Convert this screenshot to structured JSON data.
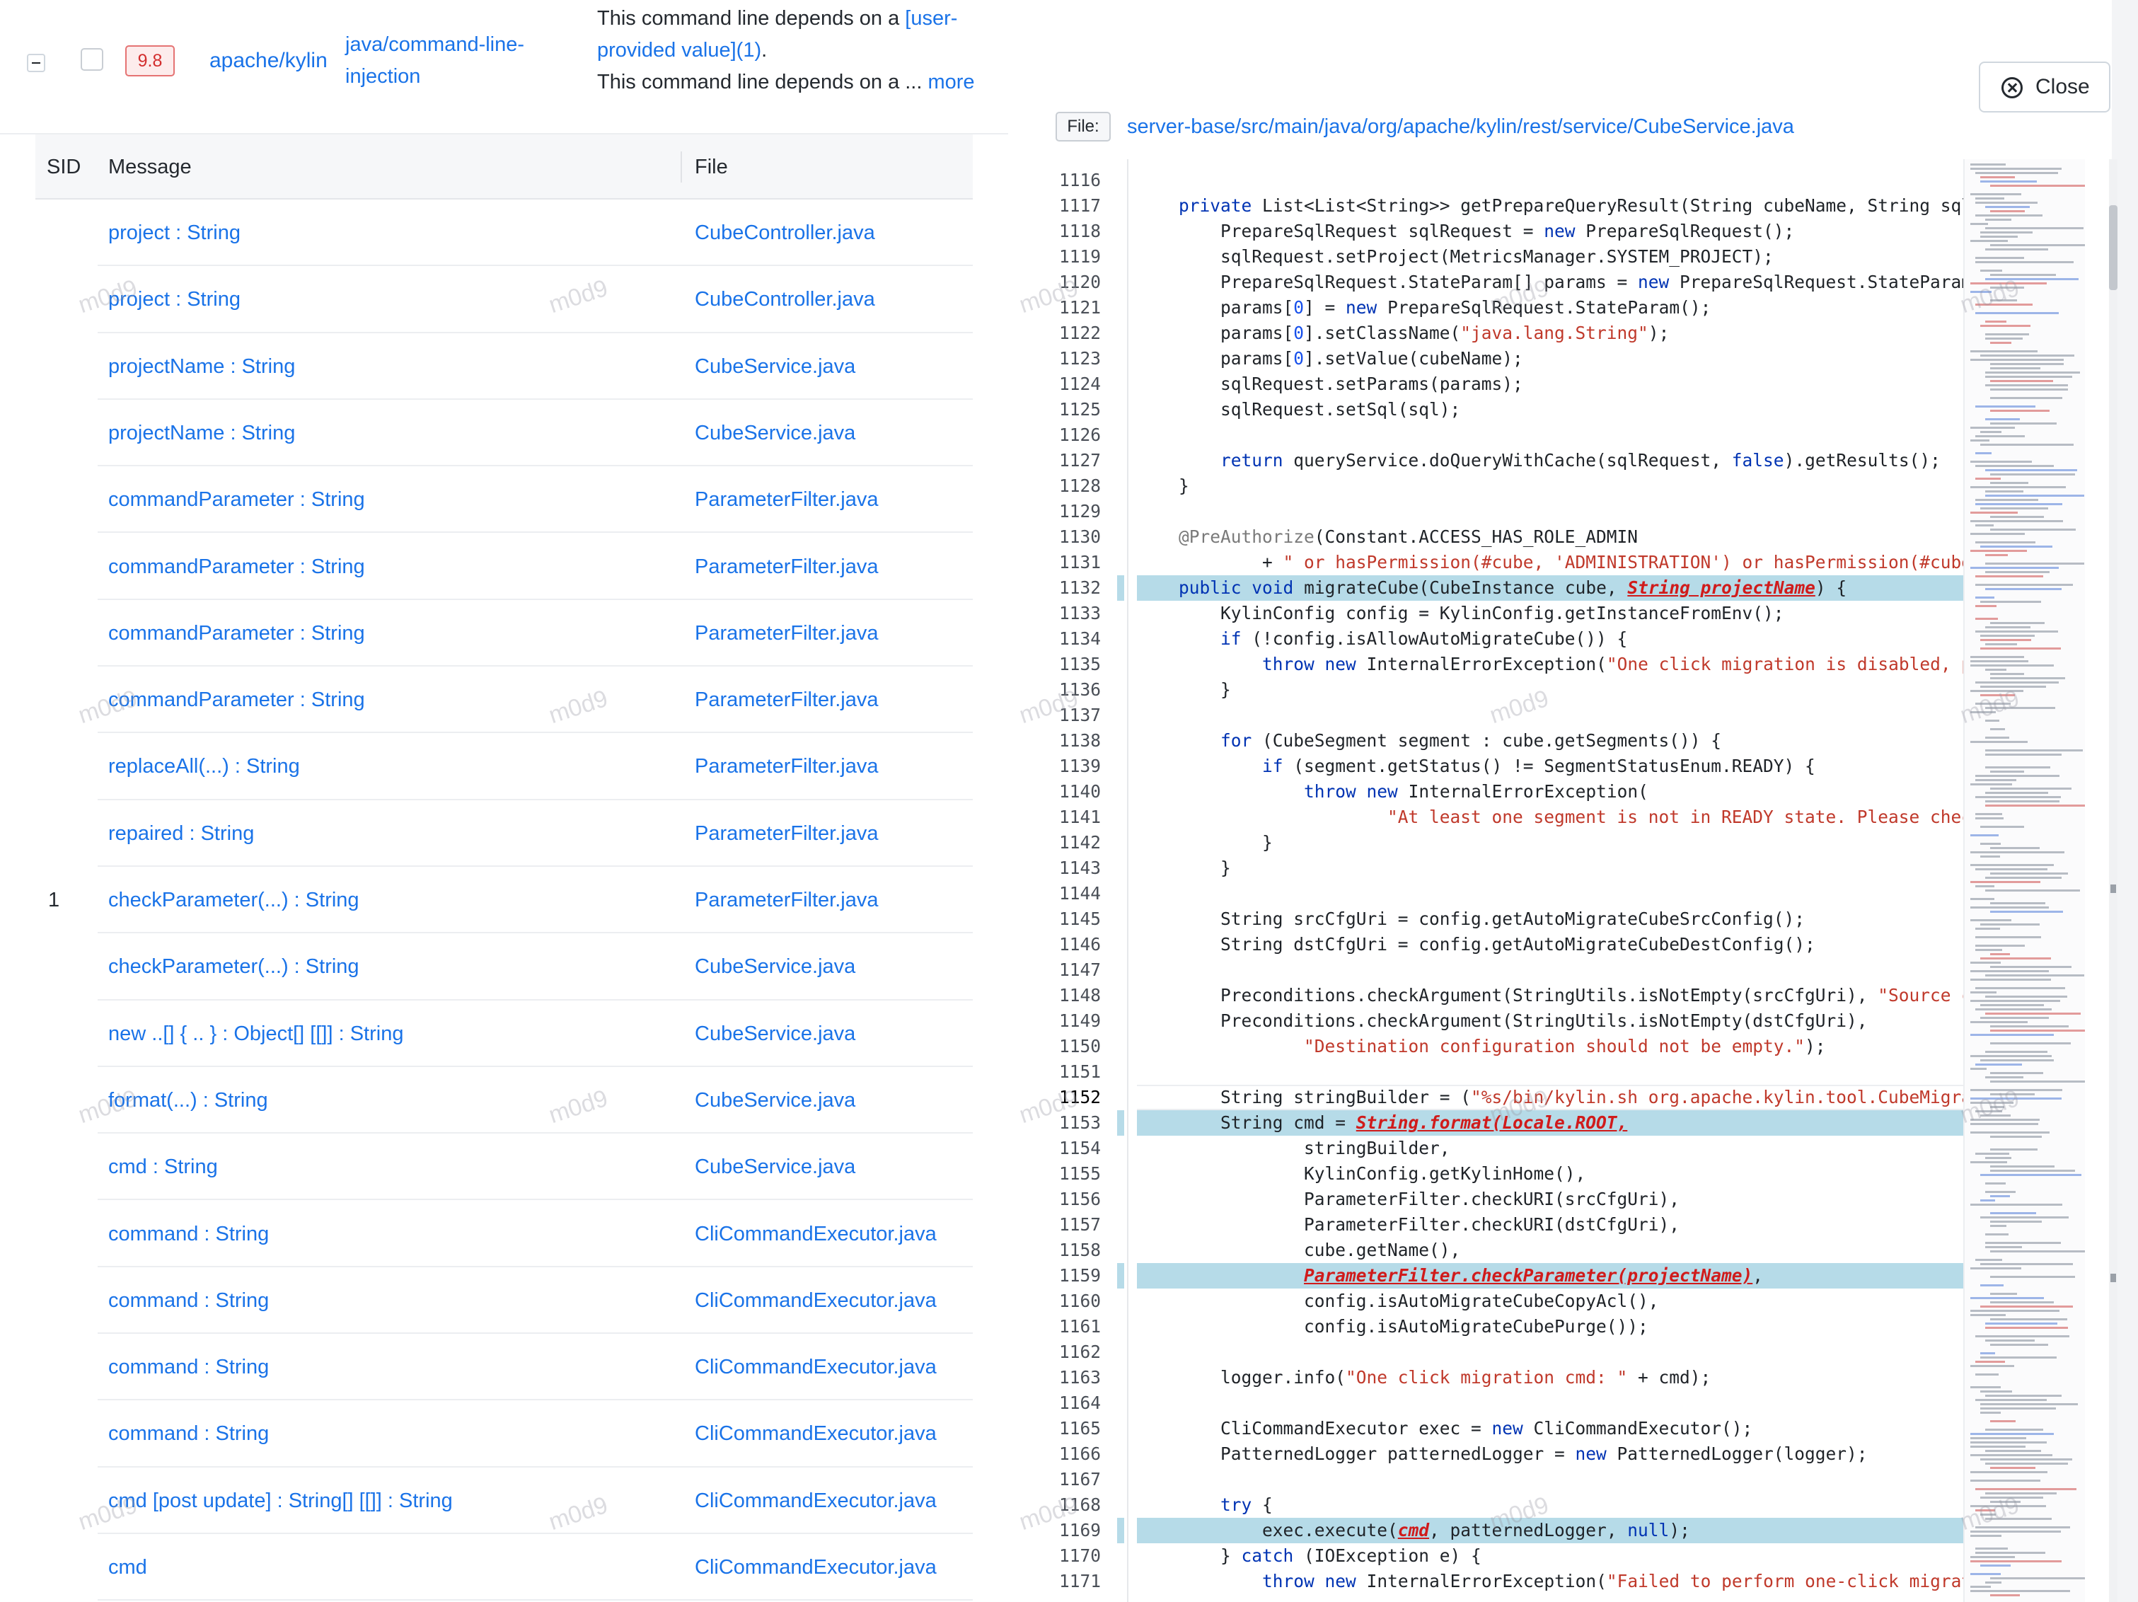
{
  "issue": {
    "score": "9.8",
    "repo": "apache/kylin",
    "rule": "java/command-line-injection",
    "message_line1": "This command line depends on a ",
    "message_link": "[user-provided value](1)",
    "message_period": ".",
    "message_line2": "This command line depends on a ... ",
    "more_label": "more"
  },
  "table": {
    "headers": {
      "sid": "SID",
      "message": "Message",
      "file": "File"
    },
    "rows": [
      {
        "sid": "",
        "message": "project : String",
        "file": "CubeController.java"
      },
      {
        "sid": "",
        "message": "project : String",
        "file": "CubeController.java"
      },
      {
        "sid": "",
        "message": "projectName : String",
        "file": "CubeService.java"
      },
      {
        "sid": "",
        "message": "projectName : String",
        "file": "CubeService.java"
      },
      {
        "sid": "",
        "message": "commandParameter : String",
        "file": "ParameterFilter.java"
      },
      {
        "sid": "",
        "message": "commandParameter : String",
        "file": "ParameterFilter.java"
      },
      {
        "sid": "",
        "message": "commandParameter : String",
        "file": "ParameterFilter.java"
      },
      {
        "sid": "",
        "message": "commandParameter : String",
        "file": "ParameterFilter.java"
      },
      {
        "sid": "",
        "message": "replaceAll(...) : String",
        "file": "ParameterFilter.java"
      },
      {
        "sid": "",
        "message": "repaired : String",
        "file": "ParameterFilter.java"
      },
      {
        "sid": "1",
        "message": "checkParameter(...) : String",
        "file": "ParameterFilter.java"
      },
      {
        "sid": "",
        "message": "checkParameter(...) : String",
        "file": "CubeService.java"
      },
      {
        "sid": "",
        "message": "new ..[] { .. } : Object[] [[]] : String",
        "file": "CubeService.java"
      },
      {
        "sid": "",
        "message": "format(...) : String",
        "file": "CubeService.java"
      },
      {
        "sid": "",
        "message": "cmd : String",
        "file": "CubeService.java"
      },
      {
        "sid": "",
        "message": "command : String",
        "file": "CliCommandExecutor.java"
      },
      {
        "sid": "",
        "message": "command : String",
        "file": "CliCommandExecutor.java"
      },
      {
        "sid": "",
        "message": "command : String",
        "file": "CliCommandExecutor.java"
      },
      {
        "sid": "",
        "message": "command : String",
        "file": "CliCommandExecutor.java"
      },
      {
        "sid": "",
        "message": "cmd [post update] : String[] [[]] : String",
        "file": "CliCommandExecutor.java"
      },
      {
        "sid": "",
        "message": "cmd",
        "file": "CliCommandExecutor.java"
      }
    ]
  },
  "viewer": {
    "close_label": "Close",
    "file_label": "File:",
    "file_path": "server-base/src/main/java/org/apache/kylin/rest/service/CubeService.java",
    "current_line": "1152",
    "highlighted_lines": [
      "1132",
      "1153",
      "1159",
      "1169"
    ]
  },
  "code_lines": [
    {
      "n": "1116",
      "t": ""
    },
    {
      "n": "1117",
      "t": "    private List<List<String>> getPrepareQueryResult(String cubeName, String sql"
    },
    {
      "n": "1118",
      "t": "        PrepareSqlRequest sqlRequest = new PrepareSqlRequest();"
    },
    {
      "n": "1119",
      "t": "        sqlRequest.setProject(MetricsManager.SYSTEM_PROJECT);"
    },
    {
      "n": "1120",
      "t": "        PrepareSqlRequest.StateParam[] params = new PrepareSqlRequest.StateParam"
    },
    {
      "n": "1121",
      "t": "        params[0] = new PrepareSqlRequest.StateParam();"
    },
    {
      "n": "1122",
      "t": "        params[0].setClassName(\"java.lang.String\");"
    },
    {
      "n": "1123",
      "t": "        params[0].setValue(cubeName);"
    },
    {
      "n": "1124",
      "t": "        sqlRequest.setParams(params);"
    },
    {
      "n": "1125",
      "t": "        sqlRequest.setSql(sql);"
    },
    {
      "n": "1126",
      "t": ""
    },
    {
      "n": "1127",
      "t": "        return queryService.doQueryWithCache(sqlRequest, false).getResults();"
    },
    {
      "n": "1128",
      "t": "    }"
    },
    {
      "n": "1129",
      "t": ""
    },
    {
      "n": "1130",
      "t": "    @PreAuthorize(Constant.ACCESS_HAS_ROLE_ADMIN"
    },
    {
      "n": "1131",
      "t": "            + \" or hasPermission(#cube, 'ADMINISTRATION') or hasPermission(#cube"
    },
    {
      "n": "1132",
      "t": "    public void migrateCube(CubeInstance cube, String projectName) {"
    },
    {
      "n": "1133",
      "t": "        KylinConfig config = KylinConfig.getInstanceFromEnv();"
    },
    {
      "n": "1134",
      "t": "        if (!config.isAllowAutoMigrateCube()) {"
    },
    {
      "n": "1135",
      "t": "            throw new InternalErrorException(\"One click migration is disabled, p"
    },
    {
      "n": "1136",
      "t": "        }"
    },
    {
      "n": "1137",
      "t": ""
    },
    {
      "n": "1138",
      "t": "        for (CubeSegment segment : cube.getSegments()) {"
    },
    {
      "n": "1139",
      "t": "            if (segment.getStatus() != SegmentStatusEnum.READY) {"
    },
    {
      "n": "1140",
      "t": "                throw new InternalErrorException("
    },
    {
      "n": "1141",
      "t": "                        \"At least one segment is not in READY state. Please chec"
    },
    {
      "n": "1142",
      "t": "            }"
    },
    {
      "n": "1143",
      "t": "        }"
    },
    {
      "n": "1144",
      "t": ""
    },
    {
      "n": "1145",
      "t": "        String srcCfgUri = config.getAutoMigrateCubeSrcConfig();"
    },
    {
      "n": "1146",
      "t": "        String dstCfgUri = config.getAutoMigrateCubeDestConfig();"
    },
    {
      "n": "1147",
      "t": ""
    },
    {
      "n": "1148",
      "t": "        Preconditions.checkArgument(StringUtils.isNotEmpty(srcCfgUri), \"Source c"
    },
    {
      "n": "1149",
      "t": "        Preconditions.checkArgument(StringUtils.isNotEmpty(dstCfgUri),"
    },
    {
      "n": "1150",
      "t": "                \"Destination configuration should not be empty.\");"
    },
    {
      "n": "1151",
      "t": ""
    },
    {
      "n": "1152",
      "t": "        String stringBuilder = (\"%s/bin/kylin.sh org.apache.kylin.tool.CubeMigra"
    },
    {
      "n": "1153",
      "t": "        String cmd = String.format(Locale.ROOT,"
    },
    {
      "n": "1154",
      "t": "                stringBuilder,"
    },
    {
      "n": "1155",
      "t": "                KylinConfig.getKylinHome(),"
    },
    {
      "n": "1156",
      "t": "                ParameterFilter.checkURI(srcCfgUri),"
    },
    {
      "n": "1157",
      "t": "                ParameterFilter.checkURI(dstCfgUri),"
    },
    {
      "n": "1158",
      "t": "                cube.getName(),"
    },
    {
      "n": "1159",
      "t": "                ParameterFilter.checkParameter(projectName),"
    },
    {
      "n": "1160",
      "t": "                config.isAutoMigrateCubeCopyAcl(),"
    },
    {
      "n": "1161",
      "t": "                config.isAutoMigrateCubePurge());"
    },
    {
      "n": "1162",
      "t": ""
    },
    {
      "n": "1163",
      "t": "        logger.info(\"One click migration cmd: \" + cmd);"
    },
    {
      "n": "1164",
      "t": ""
    },
    {
      "n": "1165",
      "t": "        CliCommandExecutor exec = new CliCommandExecutor();"
    },
    {
      "n": "1166",
      "t": "        PatternedLogger patternedLogger = new PatternedLogger(logger);"
    },
    {
      "n": "1167",
      "t": ""
    },
    {
      "n": "1168",
      "t": "        try {"
    },
    {
      "n": "1169",
      "t": "            exec.execute(cmd, patternedLogger, null);"
    },
    {
      "n": "1170",
      "t": "        } catch (IOException e) {"
    },
    {
      "n": "1171",
      "t": "            throw new InternalErrorException(\"Failed to perform one-click migrat"
    }
  ],
  "watermark": "m0d9",
  "colors": {
    "link": "#1a73e8",
    "highlight": "#b6dbe8",
    "badge_text": "#d32f2f",
    "keyword": "#0033b3",
    "string": "#c0392b",
    "flow_step": "#d01b1b"
  }
}
